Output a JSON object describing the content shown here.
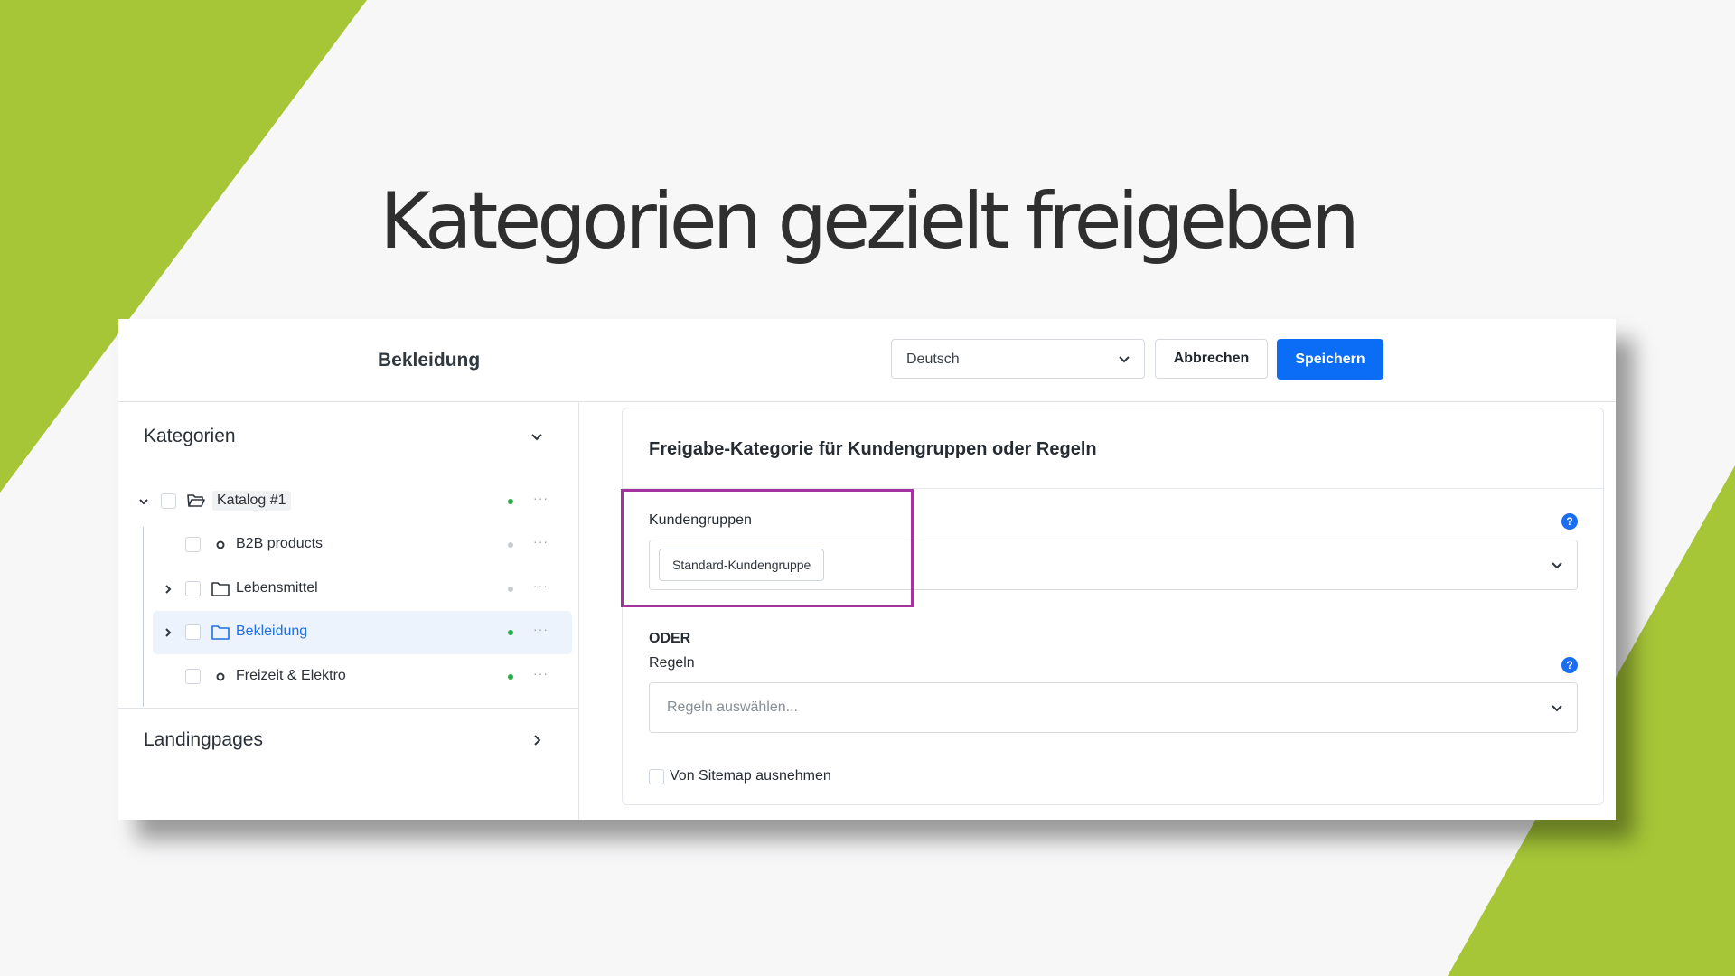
{
  "headline": "Kategorien gezielt freigeben",
  "colors": {
    "accent_green": "#a6c637",
    "primary_blue": "#0b6df5",
    "highlight_magenta": "#a5329e",
    "status_green": "#27b04a",
    "status_gray": "#c7ccd1"
  },
  "topbar": {
    "title": "Bekleidung",
    "language": "Deutsch",
    "cancel_label": "Abbrechen",
    "save_label": "Speichern"
  },
  "sidebar": {
    "categories_header": "Kategorien",
    "landingpages_header": "Landingpages",
    "tree": [
      {
        "label": "Katalog #1",
        "icon": "folder-open-icon",
        "status": "active",
        "expander": "chevron-down-icon"
      },
      {
        "label": "B2B products",
        "icon": "circle-icon",
        "status": "inactive",
        "expander": ""
      },
      {
        "label": "Lebensmittel",
        "icon": "folder-icon",
        "status": "inactive",
        "expander": "chevron-right-icon"
      },
      {
        "label": "Bekleidung",
        "icon": "folder-icon",
        "status": "active",
        "expander": "chevron-right-icon",
        "selected": true
      },
      {
        "label": "Freizeit & Elektro",
        "icon": "circle-icon",
        "status": "active",
        "expander": ""
      }
    ],
    "more_label": "···"
  },
  "card": {
    "title": "Freigabe-Kategorie für Kundengruppen oder Regeln",
    "customer_groups_label": "Kundengruppen",
    "customer_group_tag": "Standard-Kundengruppe",
    "or_label": "ODER",
    "rules_label": "Regeln",
    "rules_placeholder": "Regeln auswählen...",
    "sitemap_checkbox_label": "Von Sitemap ausnehmen",
    "help_glyph": "?"
  }
}
